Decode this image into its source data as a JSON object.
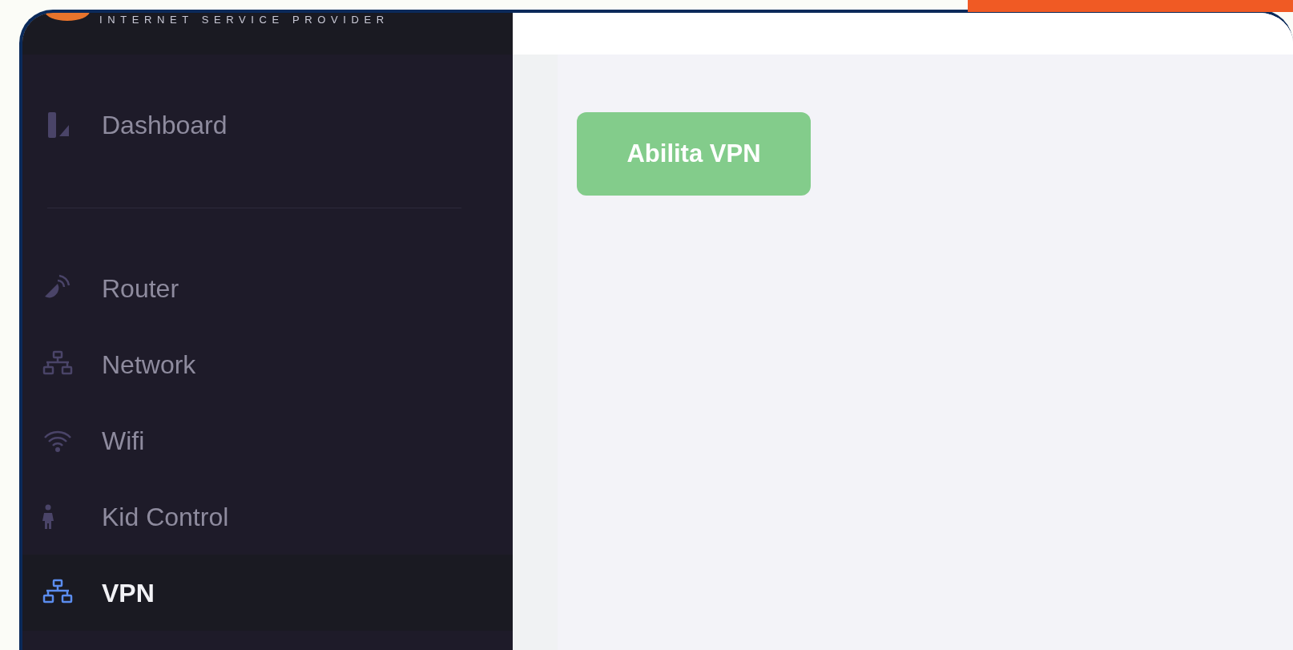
{
  "brand": {
    "tagline": "INTERNET SERVICE PROVIDER"
  },
  "sidebar": {
    "sections": [
      {
        "items": [
          {
            "label": "Dashboard",
            "selected": false
          }
        ]
      },
      {
        "items": [
          {
            "label": "Router",
            "selected": false
          },
          {
            "label": "Network",
            "selected": false
          },
          {
            "label": "Wifi",
            "selected": false
          },
          {
            "label": "Kid Control",
            "selected": false
          },
          {
            "label": "VPN",
            "selected": true
          }
        ]
      }
    ]
  },
  "main": {
    "button": "Abilita VPN"
  }
}
